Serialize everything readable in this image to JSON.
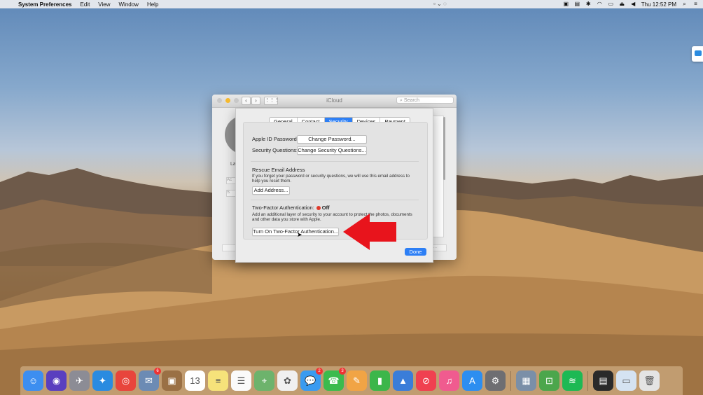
{
  "menubar": {
    "app_name": "System Preferences",
    "items": [
      "Edit",
      "View",
      "Window",
      "Help"
    ],
    "clock": "Thu 12:52 PM",
    "status_icons": [
      "display-icon",
      "keyboard-icon",
      "bluetooth-icon",
      "wifi-icon",
      "airplay-icon",
      "eject-icon",
      "volume-icon"
    ]
  },
  "window": {
    "title": "iCloud",
    "search_placeholder": "Search",
    "back_label": "La",
    "back_button_1": "Ac",
    "back_button_2": "S",
    "back_bottom_right": "age..."
  },
  "sheet": {
    "tabs": [
      {
        "label": "General",
        "active": false
      },
      {
        "label": "Contact",
        "active": false
      },
      {
        "label": "Security",
        "active": true
      },
      {
        "label": "Devices",
        "active": false
      },
      {
        "label": "Payment",
        "active": false
      }
    ],
    "apple_id_password_label": "Apple ID Password:",
    "change_password_button": "Change Password...",
    "security_questions_label": "Security Questions:",
    "change_security_questions_button": "Change Security Questions...",
    "rescue_email_heading": "Rescue Email Address",
    "rescue_email_desc_1": "If you forget your password or security questions, we will use this email address to",
    "rescue_email_desc_2": "help you reset them.",
    "add_address_button": "Add Address...",
    "two_factor_label": "Two-Factor Authentication:",
    "two_factor_status": "Off",
    "two_factor_desc_1": "Add an additional layer of security to your account to protect the photos, documents",
    "two_factor_desc_2": "and other data you store with Apple.",
    "turn_on_button": "Turn On Two-Factor Authentication...",
    "done_button": "Done"
  },
  "colors": {
    "accent": "#2d7ff5",
    "status_off": "#e0392b",
    "annotation_arrow": "#e8141c"
  },
  "dock": {
    "apps": [
      {
        "name": "finder-icon",
        "color": "#3d8ef0",
        "glyph": "☺"
      },
      {
        "name": "siri-icon",
        "color": "#5a3fbf",
        "glyph": "◉"
      },
      {
        "name": "launchpad-icon",
        "color": "#8c8c95",
        "glyph": "✈"
      },
      {
        "name": "safari-icon",
        "color": "#2a8be0",
        "glyph": "✦"
      },
      {
        "name": "chrome-icon",
        "color": "#e8453c",
        "glyph": "◎"
      },
      {
        "name": "mail-icon",
        "color": "#6c8bb4",
        "glyph": "✉",
        "badge": "6"
      },
      {
        "name": "contacts-icon",
        "color": "#9a7045",
        "glyph": "▣"
      },
      {
        "name": "calendar-icon",
        "color": "#ffffff",
        "glyph": "13"
      },
      {
        "name": "notes-icon",
        "color": "#f6e27a",
        "glyph": "≡"
      },
      {
        "name": "reminders-icon",
        "color": "#fafafa",
        "glyph": "☰"
      },
      {
        "name": "maps-icon",
        "color": "#6db36c",
        "glyph": "⌖"
      },
      {
        "name": "photos-icon",
        "color": "#f0f0f0",
        "glyph": "✿"
      },
      {
        "name": "messages-icon",
        "color": "#3a9bf0",
        "glyph": "💬",
        "badge": "2"
      },
      {
        "name": "facetime-icon",
        "color": "#3bbb4d",
        "glyph": "☎",
        "badge": "3"
      },
      {
        "name": "pages-icon",
        "color": "#f1a445",
        "glyph": "✎"
      },
      {
        "name": "numbers-icon",
        "color": "#3cb64a",
        "glyph": "▮"
      },
      {
        "name": "keynote-icon",
        "color": "#3a7dd9",
        "glyph": "▲"
      },
      {
        "name": "news-icon",
        "color": "#f04050",
        "glyph": "⊘"
      },
      {
        "name": "itunes-icon",
        "color": "#f05b8f",
        "glyph": "♫"
      },
      {
        "name": "app-store-icon",
        "color": "#2d8ef0",
        "glyph": "A"
      },
      {
        "name": "system-preferences-icon",
        "color": "#6e6e72",
        "glyph": "⚙"
      },
      {
        "name": "separator"
      },
      {
        "name": "preview-icon",
        "color": "#7a8fa8",
        "glyph": "▦"
      },
      {
        "name": "teamviewer-icon",
        "color": "#4ca64c",
        "glyph": "⊡"
      },
      {
        "name": "spotify-icon",
        "color": "#1db954",
        "glyph": "≋"
      },
      {
        "name": "separator"
      },
      {
        "name": "terminal-icon",
        "color": "#2a2a2a",
        "glyph": "▤"
      },
      {
        "name": "downloads-icon",
        "color": "#d5e3f2",
        "glyph": "▭"
      },
      {
        "name": "trash-icon",
        "color": "#e4e4e4",
        "glyph": "🗑"
      }
    ]
  }
}
